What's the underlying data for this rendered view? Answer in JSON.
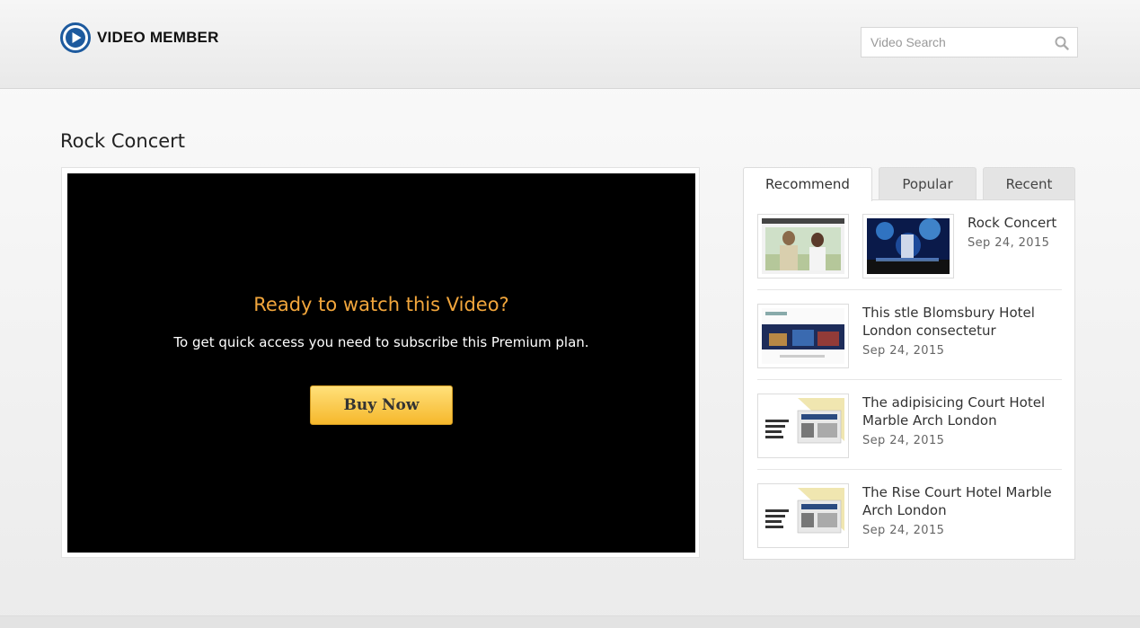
{
  "header": {
    "logo_text": "VIDEO MEMBER",
    "search_placeholder": "Video Search"
  },
  "page": {
    "title": "Rock Concert"
  },
  "player": {
    "prompt_title": "Ready to watch this Video?",
    "prompt_text": "To get quick access you need to subscribe this Premium plan.",
    "buy_label": "Buy Now"
  },
  "sidebar": {
    "tabs": [
      {
        "label": "Recommend",
        "active": true
      },
      {
        "label": "Popular",
        "active": false
      },
      {
        "label": "Recent",
        "active": false
      }
    ],
    "items": [
      {
        "title": "Rock Concert",
        "date": "Sep 24, 2015"
      },
      {
        "title": "This stle Blomsbury Hotel London consectetur",
        "date": "Sep 24, 2015"
      },
      {
        "title": "The adipisicing Court Hotel Marble Arch London",
        "date": "Sep 24, 2015"
      },
      {
        "title": "The Rise Court Hotel Marble Arch London",
        "date": "Sep 24, 2015"
      }
    ]
  },
  "colors": {
    "accent": "#f2a63c",
    "button": "#f6b82c",
    "logo_blue": "#1d5a9e"
  }
}
